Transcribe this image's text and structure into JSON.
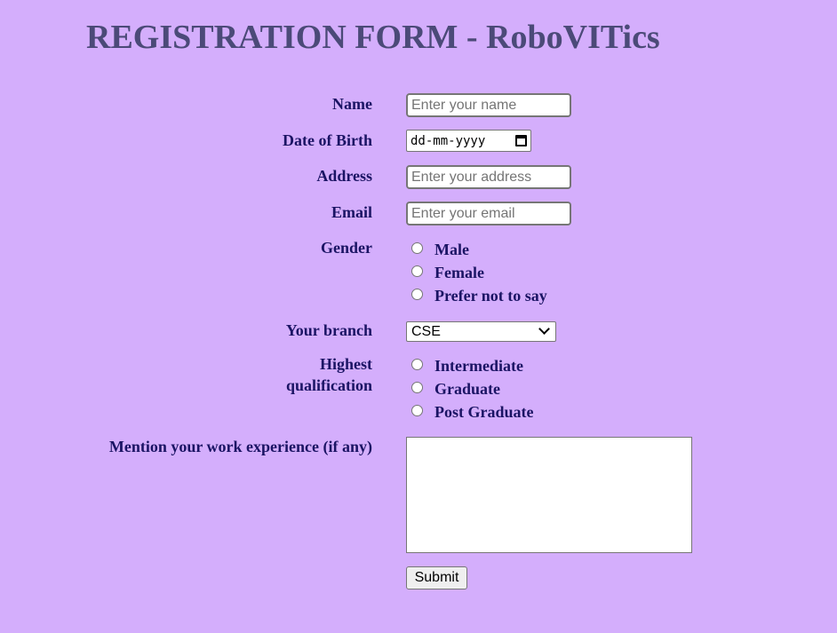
{
  "title": "REGISTRATION FORM - RoboVITics",
  "form": {
    "name": {
      "label": "Name",
      "placeholder": "Enter your name",
      "value": ""
    },
    "dob": {
      "label": "Date of Birth",
      "placeholder": "dd-mm-yyyy"
    },
    "address": {
      "label": "Address",
      "placeholder": "Enter your address",
      "value": ""
    },
    "email": {
      "label": "Email",
      "placeholder": "Enter your email",
      "value": ""
    },
    "gender": {
      "label": "Gender",
      "options": [
        "Male",
        "Female",
        "Prefer not to say"
      ]
    },
    "branch": {
      "label": "Your branch",
      "selected": "CSE"
    },
    "qualification": {
      "label": "Highest qualification",
      "options": [
        "Intermediate",
        "Graduate",
        "Post Graduate"
      ]
    },
    "experience": {
      "label": "Mention your work experience (if any)",
      "value": ""
    },
    "submit_label": "Submit"
  },
  "icons": {
    "date": "calendar-icon",
    "select": "chevron-down-icon"
  },
  "colors": {
    "background": "#d4aefc",
    "title": "#4b4a78",
    "label": "#1b1464"
  }
}
